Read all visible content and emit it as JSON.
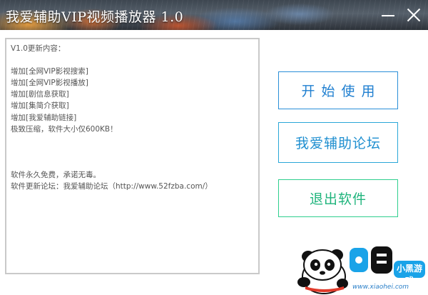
{
  "window": {
    "title": "我爱辅助VIP视频播放器 1.0"
  },
  "changelog": {
    "lines": [
      "V1.0更新内容：",
      "",
      "增加[全网VIP影视搜索]",
      "增加[全网VIP影视播放]",
      "增加[剧信息获取]",
      "增加[集简介获取]",
      "增加[我爱辅助链接]",
      "极致压缩，软件大小仅600KB！",
      "",
      "",
      "",
      "软件永久免费，承诺无毒。",
      "软件更新论坛：我爱辅助论坛（http://www.52fzba.com/）"
    ]
  },
  "buttons": {
    "start": "开始使用",
    "forum": "我爱辅助论坛",
    "exit": "退出软件"
  },
  "watermark": {
    "brand": "小黑游戏",
    "url": "www.xiaohei.com"
  },
  "colors": {
    "accent_blue": "#1f7fd0",
    "accent_green": "#1fb47c"
  }
}
